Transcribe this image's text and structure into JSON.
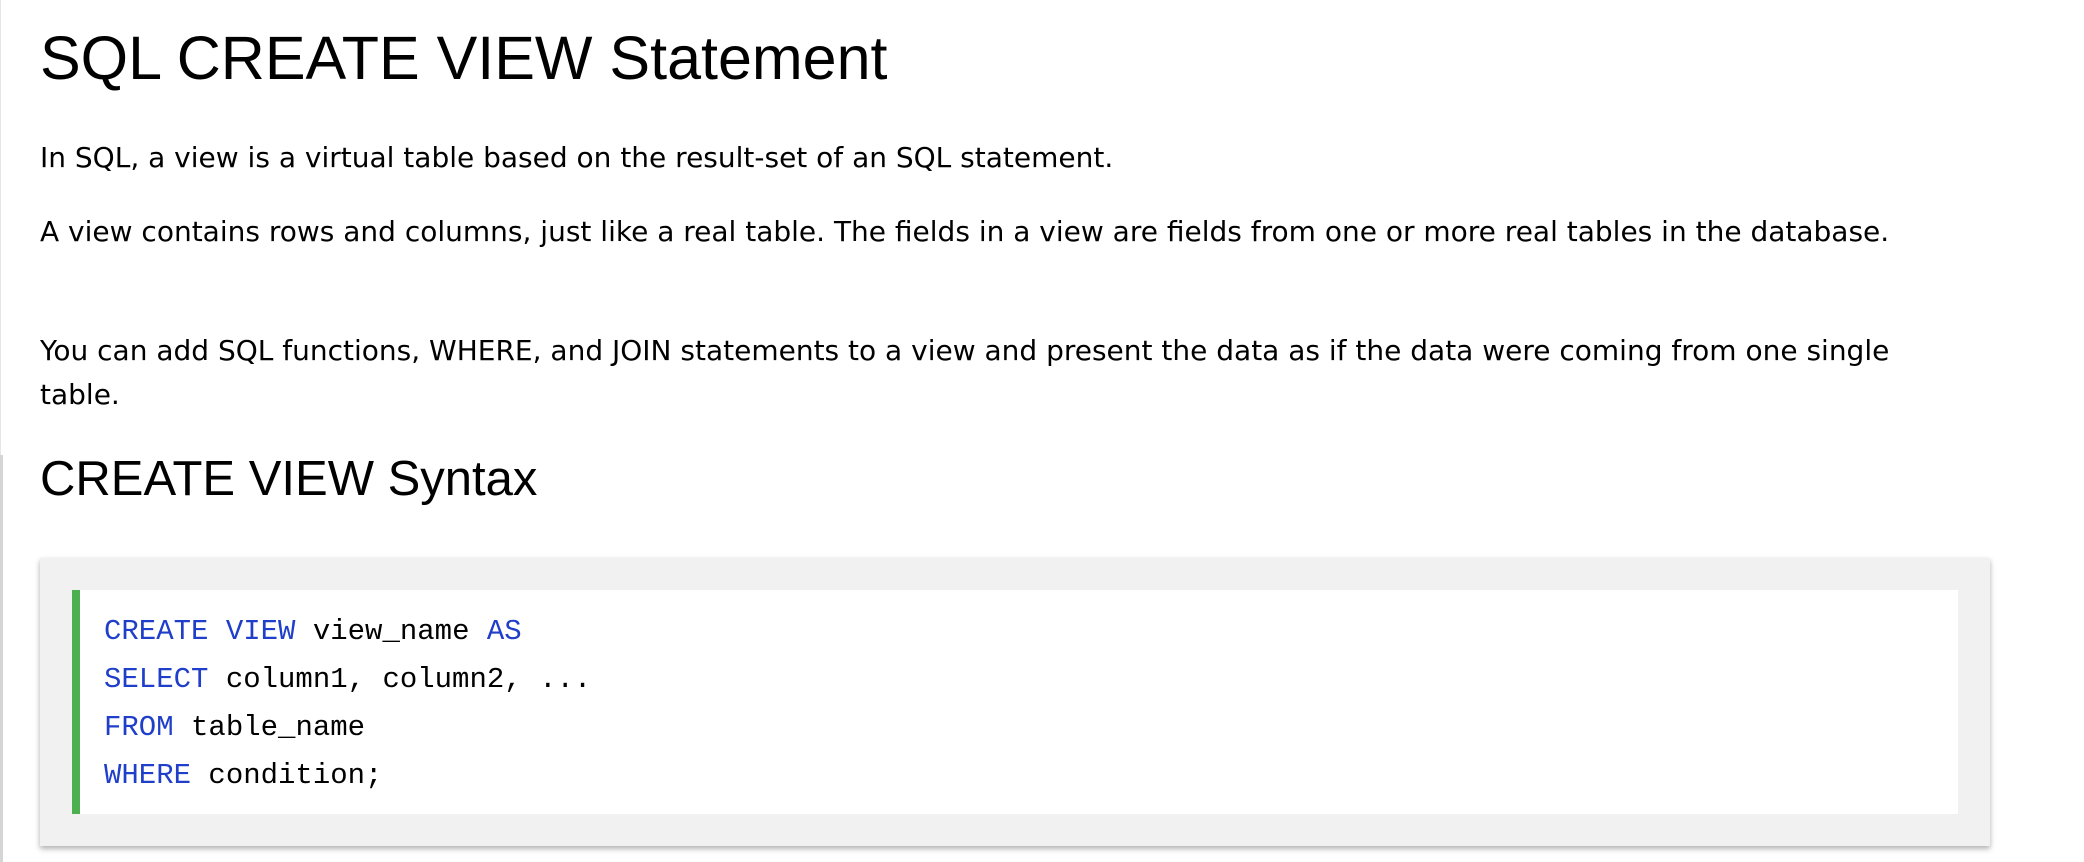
{
  "page_title": "SQL CREATE VIEW Statement",
  "paragraphs": [
    "In SQL, a view is a virtual table based on the result-set of an SQL statement.",
    "A view contains rows and columns, just like a real table. The fields in a view are fields from one or more real tables in the database.",
    "You can add SQL functions, WHERE, and JOIN statements to a view and present the data as if the data were coming from one single table."
  ],
  "syntax_heading": "CREATE VIEW Syntax",
  "code": {
    "lines": [
      {
        "kw1": "CREATE VIEW",
        "rest1": " view_name ",
        "kw2": "AS"
      },
      {
        "kw1": "SELECT",
        "rest1": " column1, column2, ..."
      },
      {
        "kw1": "FROM",
        "rest1": " table_name"
      },
      {
        "kw1": "WHERE",
        "rest1": " condition;"
      }
    ]
  },
  "colors": {
    "keyword": "#1f3ec9",
    "accent_border": "#4caf50",
    "example_background": "#f1f1f1"
  }
}
